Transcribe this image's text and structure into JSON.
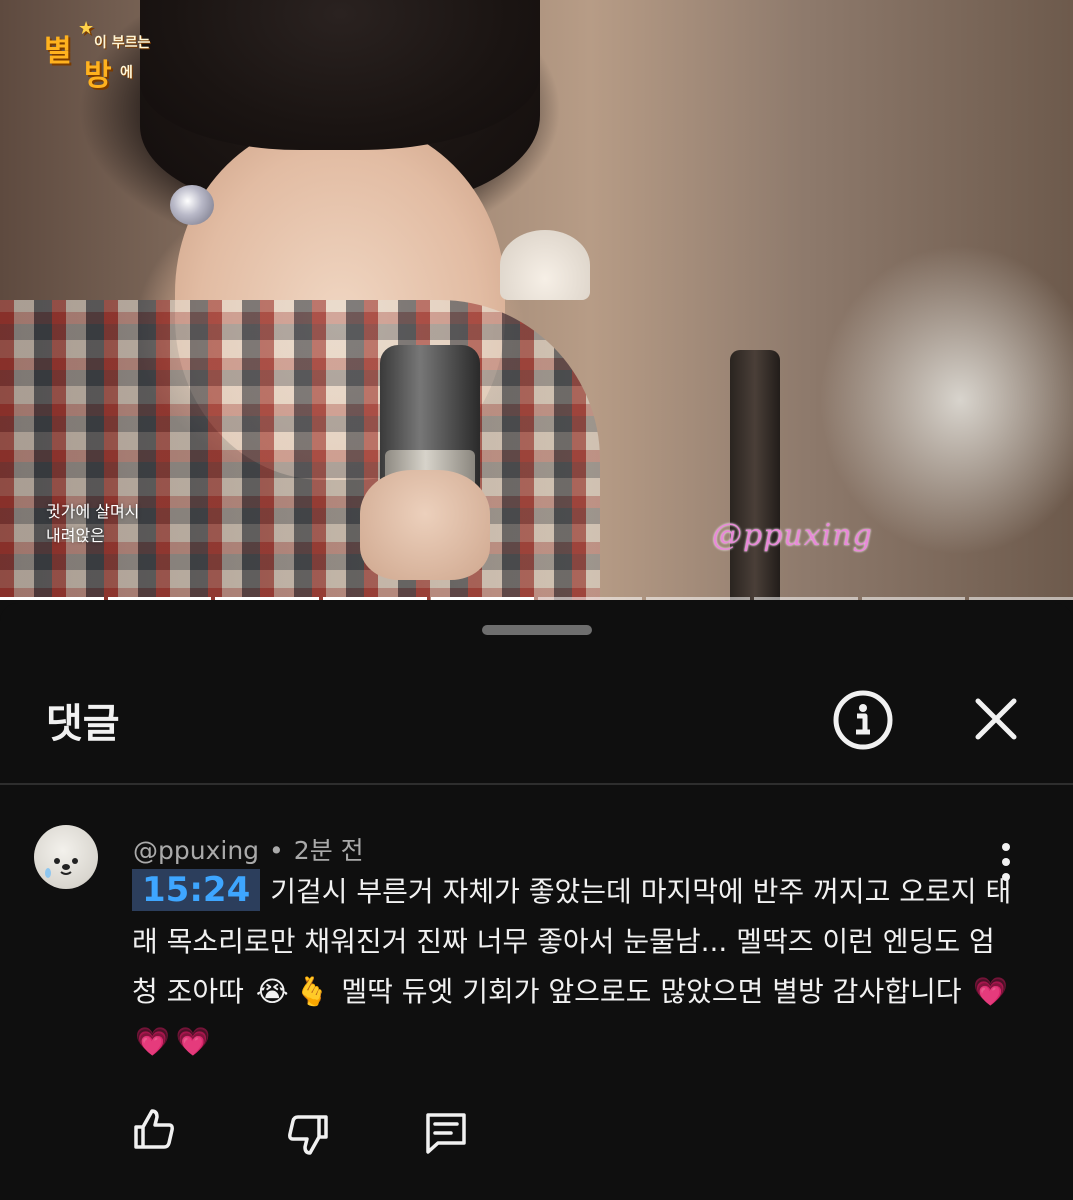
{
  "video": {
    "logo": {
      "line1": "별",
      "line1b": "이 부르는",
      "line2": "방",
      "line2b": "에"
    },
    "caption_lines": [
      "귓가에 살며시",
      "내려앉은"
    ],
    "watermark": "@ppuxing",
    "progress_segments": 10,
    "progress_played_fraction": 0.57
  },
  "comments_panel": {
    "title": "댓글",
    "info_icon": "info-circle-icon",
    "close_icon": "close-x-icon"
  },
  "comment": {
    "author": "@ppuxing",
    "separator": "•",
    "time_ago": "2분 전",
    "timestamp": "15:24",
    "text_part1": "기겉시 부른거 자체가 좋았는데 마지막에 반주 꺼지고 오로지 태래 목소리로만 채워진거 진짜 너무 좋아서 눈물남... 멜딱즈 이런 엔딩도 엄청 조아따",
    "emoji_cry": "😭",
    "emoji_hand": "🫰",
    "text_part2": "멜딱 듀엣 기회가 앞으로도 많았으면 별방 감사합니다",
    "hearts": [
      "💗",
      "💗",
      "💗"
    ],
    "actions": [
      "thumbs-up-icon",
      "thumbs-down-icon",
      "reply-icon"
    ]
  },
  "colors": {
    "background": "#0f0f0f",
    "timestamp_text": "#3ea6ff",
    "timestamp_bg": "#2c3e5c",
    "watermark": "#e88ad8",
    "logo": "#ffb21e"
  }
}
